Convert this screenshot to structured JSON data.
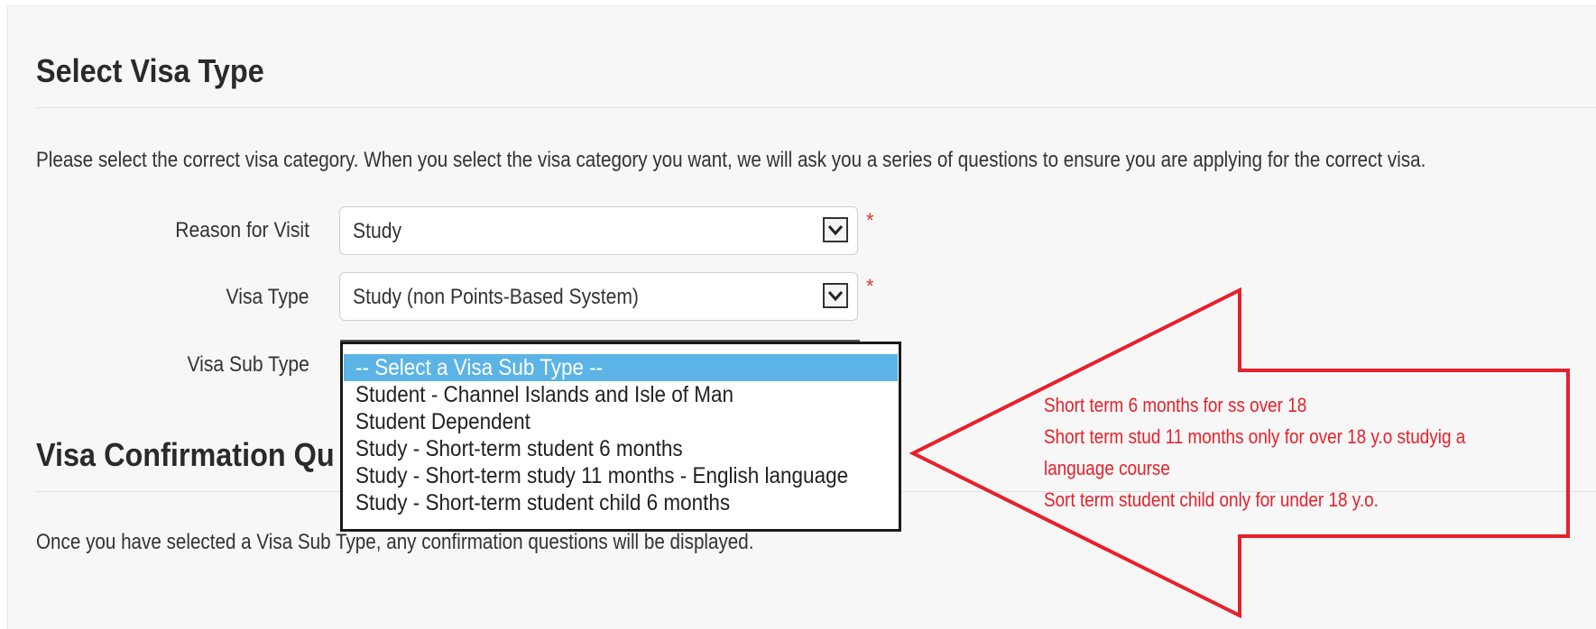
{
  "select_visa": {
    "heading": "Select Visa Type",
    "intro": "Please select the correct visa category. When you select the visa category you want, we will ask you a series of questions to ensure you are applying for the correct visa.",
    "reason_label": "Reason for Visit",
    "reason_value": "Study",
    "visa_type_label": "Visa Type",
    "visa_type_value": "Study (non Points-Based System)",
    "sub_type_label": "Visa Sub Type",
    "required_marker": "*"
  },
  "sub_type_dropdown": {
    "options": [
      "-- Select a Visa Sub Type --",
      "Student - Channel Islands and Isle of Man",
      "Student Dependent",
      "Study - Short-term student 6 months",
      "Study - Short-term study 11 months - English language",
      "Study - Short-term student child 6 months"
    ],
    "selected_index": 0,
    "highlight_color": "#5bb4e5"
  },
  "confirmation": {
    "heading": "Visa Confirmation Qu",
    "text": "Once you have selected a Visa Sub Type, any confirmation questions will be displayed."
  },
  "annotation": {
    "color": "#e8202a",
    "lines": [
      "Short term 6 months for ss over 18",
      "Short term stud 11 months only for over 18 y.o studyig a",
      "language course",
      "Sort term student child only for under 18 y.o."
    ]
  }
}
